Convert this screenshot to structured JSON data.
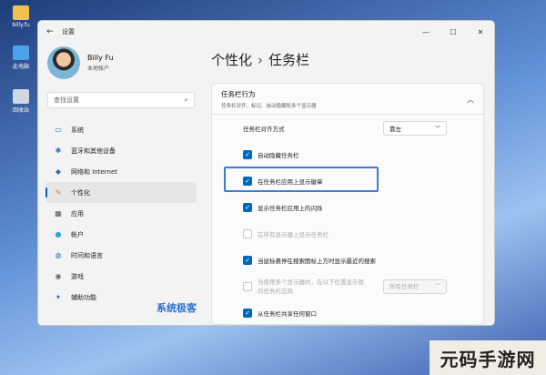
{
  "desktop": {
    "icons": [
      {
        "label": "billy.fu",
        "icon": "folder-icon",
        "color": "#f0c14b"
      },
      {
        "label": "此电脑",
        "icon": "monitor-icon",
        "color": "#4aa3e8"
      },
      {
        "label": "回收站",
        "icon": "recycle-bin-icon",
        "color": "#cfd8e0"
      }
    ]
  },
  "window": {
    "title": "设置",
    "controls": {
      "minimize": "—",
      "maximize": "☐",
      "close": "✕"
    }
  },
  "user": {
    "name": "Billy Fu",
    "account": "本地帐户"
  },
  "search": {
    "placeholder": "查找设置"
  },
  "nav": [
    {
      "label": "系统",
      "icon": "monitor-icon",
      "glyph": "▭",
      "color": "#1a73c9"
    },
    {
      "label": "蓝牙和其他设备",
      "icon": "bluetooth-icon",
      "glyph": "✱",
      "color": "#2a6fd1"
    },
    {
      "label": "网络和 Internet",
      "icon": "wifi-icon",
      "glyph": "◆",
      "color": "#2a6fd1"
    },
    {
      "label": "个性化",
      "icon": "brush-icon",
      "glyph": "✎",
      "color": "#d9822b",
      "active": true
    },
    {
      "label": "应用",
      "icon": "apps-icon",
      "glyph": "▦",
      "color": "#555"
    },
    {
      "label": "帐户",
      "icon": "person-icon",
      "glyph": "●",
      "color": "#2ea3d9"
    },
    {
      "label": "时间和语言",
      "icon": "globe-icon",
      "glyph": "◍",
      "color": "#2a6fd1"
    },
    {
      "label": "游戏",
      "icon": "gamepad-icon",
      "glyph": "◉",
      "color": "#666"
    },
    {
      "label": "辅助功能",
      "icon": "accessibility-icon",
      "glyph": "✦",
      "color": "#2a6fd1"
    }
  ],
  "breadcrumb": {
    "parent": "个性化",
    "separator": "›",
    "current": "任务栏"
  },
  "panel": {
    "title": "任务栏行为",
    "subtitle": "任务栏对齐、标记、自动隐藏和多个显示器",
    "alignment": {
      "label": "任务栏对齐方式",
      "value": "靠左"
    },
    "options": [
      {
        "label": "自动隐藏任务栏",
        "checked": true,
        "disabled": false,
        "focused": true
      },
      {
        "label": "在任务栏应用上显示徽章",
        "checked": true,
        "disabled": false
      },
      {
        "label": "显示任务栏应用上的闪烁",
        "checked": true,
        "disabled": false
      },
      {
        "label": "在所有显示器上显示任务栏",
        "checked": false,
        "disabled": true
      },
      {
        "label": "当鼠标悬停在搜索图标上方时显示最近的搜索",
        "checked": true,
        "disabled": false
      }
    ],
    "multi": {
      "line1": "当使用多个显示器时，在以下位置显示我",
      "line2": "的任务栏应用",
      "value": "所有任务栏"
    },
    "last": {
      "label": "从任务栏共享任何窗口",
      "checked": true
    }
  },
  "watermark": "系统极客",
  "banner": "元码手游网"
}
